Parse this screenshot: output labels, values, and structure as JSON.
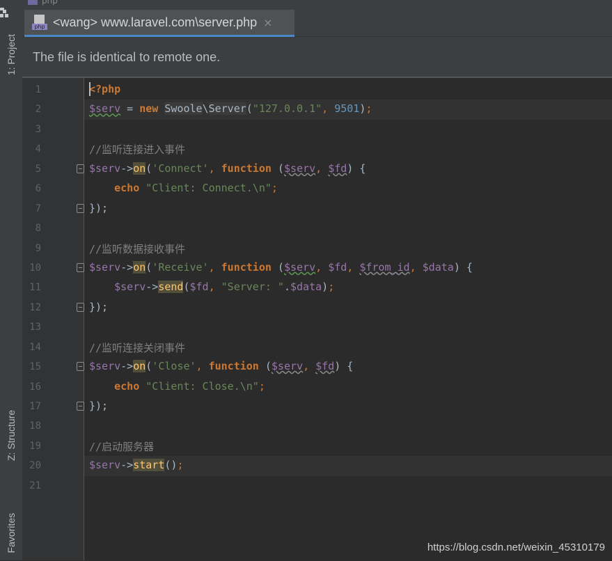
{
  "breadcrumb": {
    "text": "php"
  },
  "left_toolbar": {
    "project_label": "1: Project",
    "structure_label": "Z: Structure",
    "favorites_label": "Favorites"
  },
  "tab": {
    "icon_badge": "php",
    "title": "<wang> www.laravel.com\\server.php",
    "close_glyph": "×"
  },
  "notice": {
    "text": "The file is identical to remote one."
  },
  "line_numbers": [
    "1",
    "2",
    "3",
    "4",
    "5",
    "6",
    "7",
    "8",
    "9",
    "10",
    "11",
    "12",
    "13",
    "14",
    "15",
    "16",
    "17",
    "18",
    "19",
    "20",
    "21"
  ],
  "code": {
    "l1_open": "<?php",
    "l2_var": "$serv",
    "l2_eq": " = ",
    "l2_new": "new",
    "l2_sp": " ",
    "l2_ns": "Swoole",
    "l2_bs": "\\",
    "l2_cls": "Server",
    "l2_lp": "(",
    "l2_str": "\"127.0.0.1\"",
    "l2_comma": ", ",
    "l2_port": "9501",
    "l2_rp": ")",
    "l2_semi": ";",
    "l4_cmt": "//监听连接进入事件",
    "l5_var": "$serv",
    "l5_arrow": "->",
    "l5_on": "on",
    "l5_lp": "(",
    "l5_str": "'Connect'",
    "l5_comma": ", ",
    "l5_fn": "function",
    "l5_lp2": " (",
    "l5_a1": "$serv",
    "l5_c2": ", ",
    "l5_a2": "$fd",
    "l5_end": ") {",
    "l6_echo": "echo",
    "l6_str": "\"Client: Connect.\\n\"",
    "l6_semi": ";",
    "l7_close": "});",
    "l9_cmt": "//监听数据接收事件",
    "l10_var": "$serv",
    "l10_arrow": "->",
    "l10_on": "on",
    "l10_lp": "(",
    "l10_str": "'Receive'",
    "l10_comma": ", ",
    "l10_fn": "function",
    "l10_lp2": " (",
    "l10_a1": "$serv",
    "l10_c1": ", ",
    "l10_a2": "$fd",
    "l10_c2": ", ",
    "l10_a3": "$from_id",
    "l10_c3": ", ",
    "l10_a4": "$data",
    "l10_end": ") {",
    "l11_var": "$serv",
    "l11_arrow": "->",
    "l11_send": "send",
    "l11_lp": "(",
    "l11_a1": "$fd",
    "l11_c1": ", ",
    "l11_str": "\"Server: \"",
    "l11_dot": ".",
    "l11_a2": "$data",
    "l11_rp": ")",
    "l11_semi": ";",
    "l12_close": "});",
    "l14_cmt": "//监听连接关闭事件",
    "l15_var": "$serv",
    "l15_arrow": "->",
    "l15_on": "on",
    "l15_lp": "(",
    "l15_str": "'Close'",
    "l15_comma": ", ",
    "l15_fn": "function",
    "l15_lp2": " (",
    "l15_a1": "$serv",
    "l15_c2": ", ",
    "l15_a2": "$fd",
    "l15_end": ") {",
    "l16_echo": "echo",
    "l16_str": "\"Client: Close.\\n\"",
    "l16_semi": ";",
    "l17_close": "});",
    "l19_cmt": "//启动服务器",
    "l20_var": "$serv",
    "l20_arrow": "->",
    "l20_start": "start",
    "l20_paren": "()",
    "l20_semi": ";"
  },
  "watermark": {
    "text": "https://blog.csdn.net/weixin_45310179"
  },
  "colors": {
    "keyword": "#cc7832",
    "variable": "#9876aa",
    "string": "#6a8759",
    "number": "#6897bb",
    "comment": "#808080",
    "method": "#ffc66d",
    "tab_underline": "#4a88c7"
  }
}
